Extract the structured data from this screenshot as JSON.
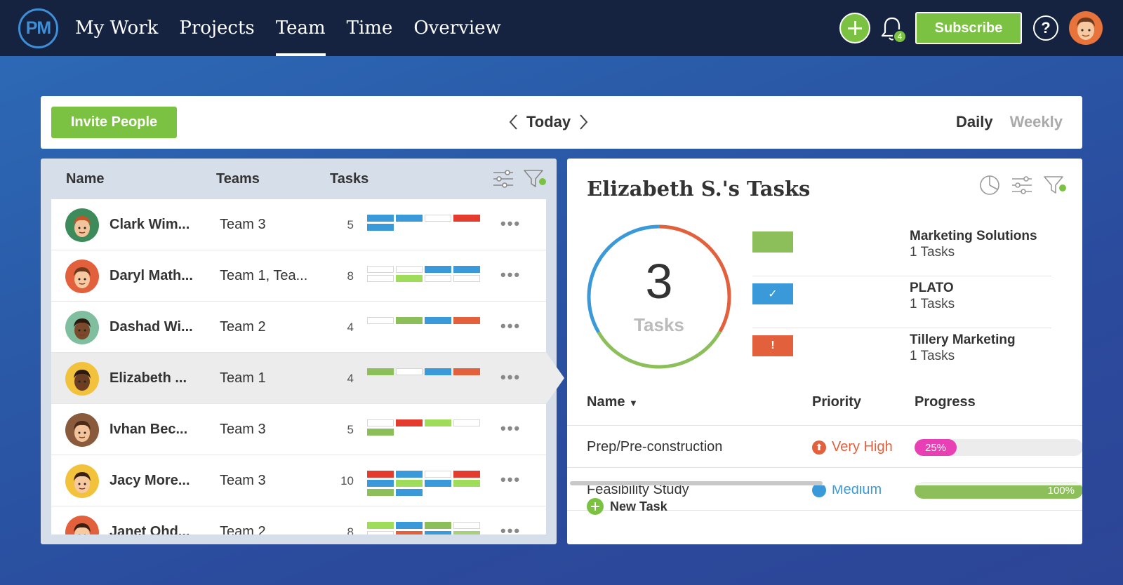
{
  "app": {
    "logo_text": "PM",
    "nav": [
      "My Work",
      "Projects",
      "Team",
      "Time",
      "Overview"
    ],
    "active_nav": "Team",
    "notification_count": "4",
    "subscribe_label": "Subscribe",
    "help_label": "?",
    "colors": {
      "topbar": "#152340",
      "accent_green": "#7cc242",
      "accent_blue": "#3e8fd8"
    }
  },
  "toolbar": {
    "invite_label": "Invite People",
    "date_label": "Today",
    "range_daily": "Daily",
    "range_weekly": "Weekly",
    "active_range": "Daily"
  },
  "team_table": {
    "headers": {
      "name": "Name",
      "teams": "Teams",
      "tasks": "Tasks"
    },
    "rows": [
      {
        "name": "Clark Wim...",
        "team": "Team 3",
        "count": "5",
        "bars": [
          [
            "blue",
            "blue",
            "empty",
            "red"
          ],
          [
            "blue"
          ]
        ]
      },
      {
        "name": "Daryl Math...",
        "team": "Team 1, Tea...",
        "count": "8",
        "bars": [
          [
            "empty",
            "empty",
            "blue",
            "blue"
          ],
          [
            "empty",
            "lime",
            "empty",
            "empty"
          ]
        ]
      },
      {
        "name": "Dashad Wi...",
        "team": "Team 2",
        "count": "4",
        "bars": [
          [
            "empty",
            "green",
            "blue",
            "orange"
          ]
        ]
      },
      {
        "name": "Elizabeth ...",
        "team": "Team 1",
        "count": "4",
        "selected": true,
        "bars": [
          [
            "green",
            "empty",
            "blue",
            "orange"
          ]
        ]
      },
      {
        "name": "Ivhan Bec...",
        "team": "Team 3",
        "count": "5",
        "bars": [
          [
            "empty",
            "red",
            "lime",
            "empty"
          ],
          [
            "green"
          ]
        ]
      },
      {
        "name": "Jacy More...",
        "team": "Team 3",
        "count": "10",
        "bars": [
          [
            "red",
            "blue",
            "empty",
            "red"
          ],
          [
            "blue",
            "lime",
            "blue",
            "lime"
          ],
          [
            "green",
            "blue"
          ]
        ]
      },
      {
        "name": "Janet Ohd...",
        "team": "Team 2",
        "count": "8",
        "bars": [
          [
            "lime",
            "blue",
            "green",
            "empty"
          ],
          [
            "empty",
            "orange",
            "blue",
            "lgreen"
          ]
        ]
      }
    ]
  },
  "detail": {
    "title": "Elizabeth S.'s Tasks",
    "total": "3",
    "total_label": "Tasks",
    "projects": [
      {
        "name": "Marketing Solutions",
        "count": "1 Tasks",
        "color": "#8cbf5a",
        "icon": ""
      },
      {
        "name": "PLATO",
        "count": "1 Tasks",
        "color": "#3a9ad9",
        "icon": "✓"
      },
      {
        "name": "Tillery Marketing",
        "count": "1 Tasks",
        "color": "#e2603c",
        "icon": "!"
      }
    ],
    "task_headers": {
      "name": "Name",
      "priority": "Priority",
      "progress": "Progress"
    },
    "tasks": [
      {
        "name": "Prep/Pre-construction",
        "priority": "Very High",
        "priority_color": "#e2603c",
        "progress": 25,
        "progress_label": "25%",
        "progress_color": "#e83fb4"
      },
      {
        "name": "Feasibility Study",
        "priority": "Medium",
        "priority_color": "#3a9ad9",
        "progress": 100,
        "progress_label": "100%",
        "progress_color": "#8cbf5a"
      }
    ],
    "new_task_label": "New Task"
  }
}
